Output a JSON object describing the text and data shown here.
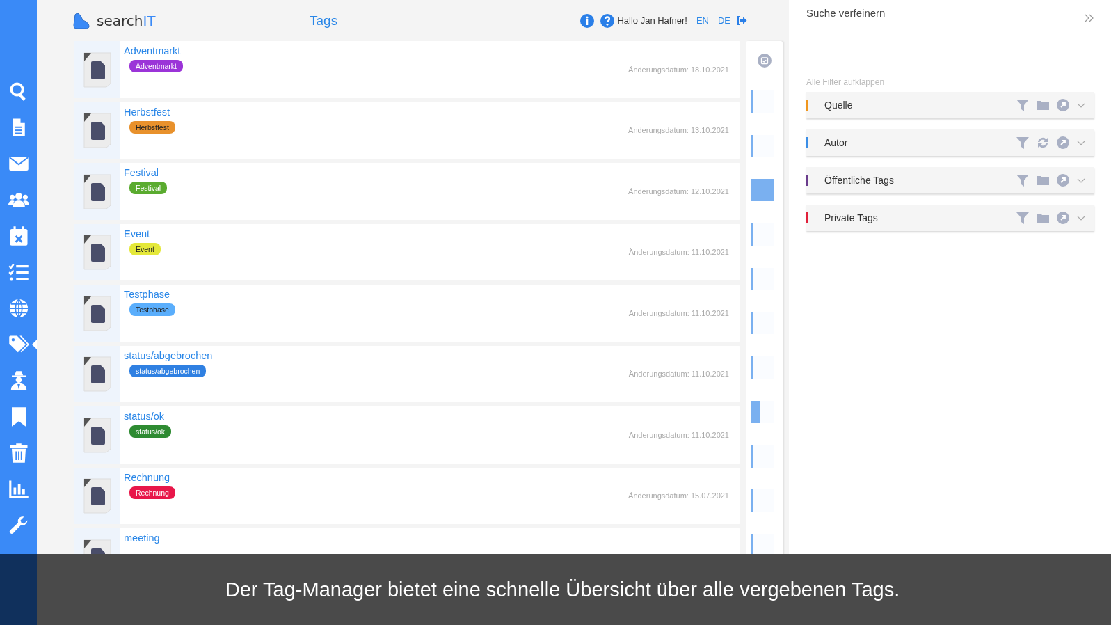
{
  "sidebar": {
    "items": [
      {
        "selected": false
      },
      {
        "selected": false
      },
      {
        "selected": false
      },
      {
        "selected": false
      },
      {
        "selected": false
      },
      {
        "selected": false
      },
      {
        "selected": false
      },
      {
        "selected": true
      },
      {
        "selected": false
      },
      {
        "selected": false
      },
      {
        "selected": false
      },
      {
        "selected": false
      },
      {
        "selected": false
      }
    ]
  },
  "header": {
    "logo_text": "search",
    "logo_accent": "IT",
    "title": "Tags",
    "greeting": "Hallo Jan Hafner!",
    "languages": [
      "EN",
      "DE"
    ]
  },
  "documents": [
    {
      "title": "Adventmarkt",
      "tag": "Adventmarkt",
      "color": "#9b34d8",
      "date": "Änderungsdatum: 18.10.2021"
    },
    {
      "title": "Herbstfest",
      "tag": "Herbstfest",
      "color": "#e8912c",
      "date": "Änderungsdatum: 13.10.2021"
    },
    {
      "title": "Festival",
      "tag": "Festival",
      "color": "#5aab2f",
      "date": "Änderungsdatum: 12.10.2021"
    },
    {
      "title": "Event",
      "tag": "Event",
      "color": "#e4e83a",
      "date": "Änderungsdatum: 11.10.2021"
    },
    {
      "title": "Testphase",
      "tag": "Testphase",
      "color": "#5aaefc",
      "date": "Änderungsdatum: 11.10.2021"
    },
    {
      "title": "status/abgebrochen",
      "tag": "status/abgebrochen",
      "color": "#2f80e2",
      "date": "Änderungsdatum: 11.10.2021"
    },
    {
      "title": "status/ok",
      "tag": "status/ok",
      "color": "#2e8b32",
      "date": "Änderungsdatum: 11.10.2021"
    },
    {
      "title": "Rechnung",
      "tag": "Rechnung",
      "color": "#e8174a",
      "date": "Änderungsdatum: 15.07.2021"
    },
    {
      "title": "meeting"
    }
  ],
  "timeline": [
    {
      "level": 0.06
    },
    {
      "level": 0.06
    },
    {
      "level": 1
    },
    {
      "level": 0.06
    },
    {
      "level": 0.06
    },
    {
      "level": 0.06
    },
    {
      "level": 0.06
    },
    {
      "level": 0.35
    },
    {
      "level": 0.06
    },
    {
      "level": 0.06
    },
    {
      "level": 0.06
    }
  ],
  "refine_panel": {
    "title": "Suche verfeinern",
    "expand_all": "Alle Filter aufklappen",
    "filters": [
      {
        "label": "Quelle",
        "color": "#f0961e",
        "kind": "folder"
      },
      {
        "label": "Autor",
        "color": "#3b8ee6",
        "kind": "refresh"
      },
      {
        "label": "Öffentliche Tags",
        "color": "#6a3c8c",
        "kind": "folder"
      },
      {
        "label": "Private Tags",
        "color": "#e0203a",
        "kind": "folder"
      }
    ]
  },
  "caption": "Der Tag-Manager bietet eine schnelle Übersicht über alle vergebenen Tags."
}
